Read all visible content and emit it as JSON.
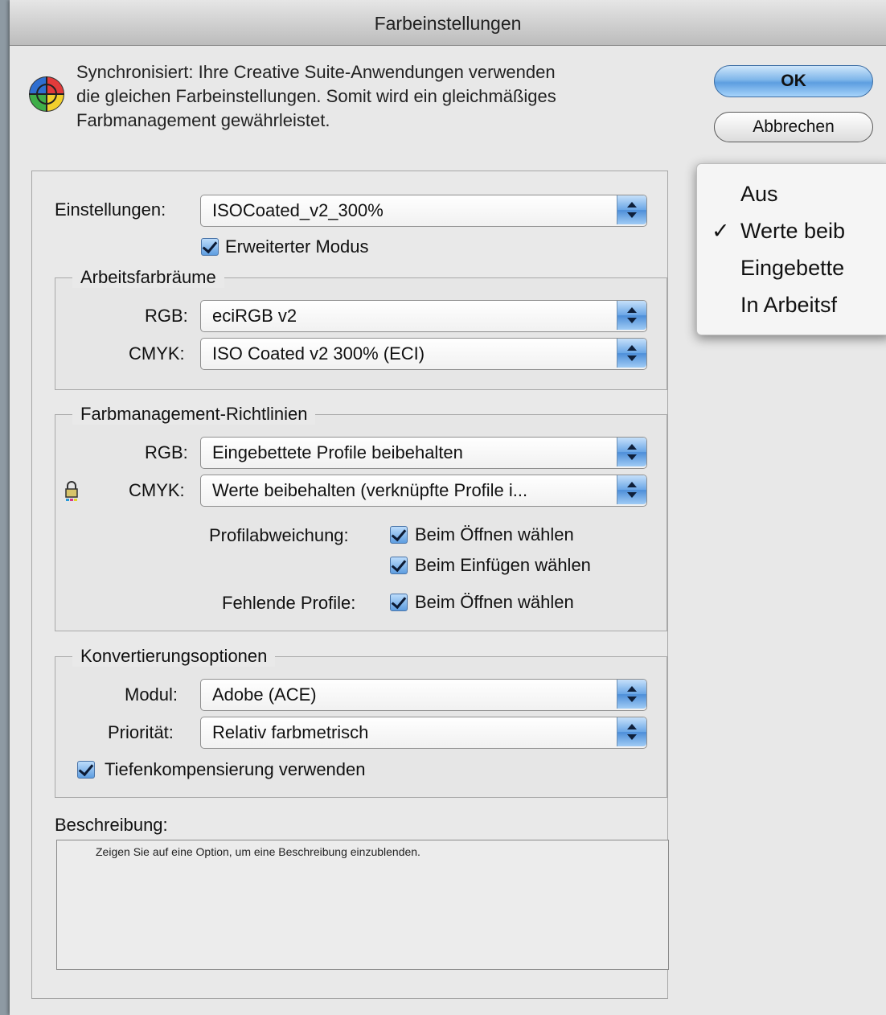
{
  "window": {
    "title": "Farbeinstellungen"
  },
  "sync": {
    "line1": "Synchronisiert: Ihre Creative Suite-Anwendungen verwenden",
    "line2": "die gleichen Farbeinstellungen. Somit wird ein gleichmäßiges",
    "line3": "Farbmanagement gewährleistet."
  },
  "buttons": {
    "ok": "OK",
    "cancel": "Abbrechen"
  },
  "settings": {
    "label": "Einstellungen:",
    "value": "ISOCoated_v2_300%",
    "advanced_label": "Erweiterter Modus",
    "advanced_checked": true
  },
  "working_spaces": {
    "title": "Arbeitsfarbräume",
    "rgb_label": "RGB:",
    "rgb_value": "eciRGB v2",
    "cmyk_label": "CMYK:",
    "cmyk_value": "ISO Coated v2 300% (ECI)"
  },
  "policies": {
    "title": "Farbmanagement-Richtlinien",
    "rgb_label": "RGB:",
    "rgb_value": "Eingebettete Profile beibehalten",
    "cmyk_label": "CMYK:",
    "cmyk_value": "Werte beibehalten (verknüpfte Profile i...",
    "mismatch_label": "Profilabweichung:",
    "mismatch_open": "Beim Öffnen wählen",
    "mismatch_paste": "Beim Einfügen wählen",
    "missing_label": "Fehlende Profile:",
    "missing_open": "Beim Öffnen wählen"
  },
  "conversion": {
    "title": "Konvertierungsoptionen",
    "engine_label": "Modul:",
    "engine_value": "Adobe (ACE)",
    "intent_label": "Priorität:",
    "intent_value": "Relativ farbmetrisch",
    "bpc_label": "Tiefenkompensierung verwenden"
  },
  "description": {
    "label": "Beschreibung:",
    "text": "Zeigen Sie auf eine Option, um eine Beschreibung einzublenden."
  },
  "dropdown_menu": {
    "items": [
      {
        "label": "Aus",
        "checked": false
      },
      {
        "label": "Werte beib",
        "checked": true
      },
      {
        "label": "Eingebette",
        "checked": false
      },
      {
        "label": "In Arbeitsf",
        "checked": false
      }
    ],
    "check_mark": "✓"
  }
}
